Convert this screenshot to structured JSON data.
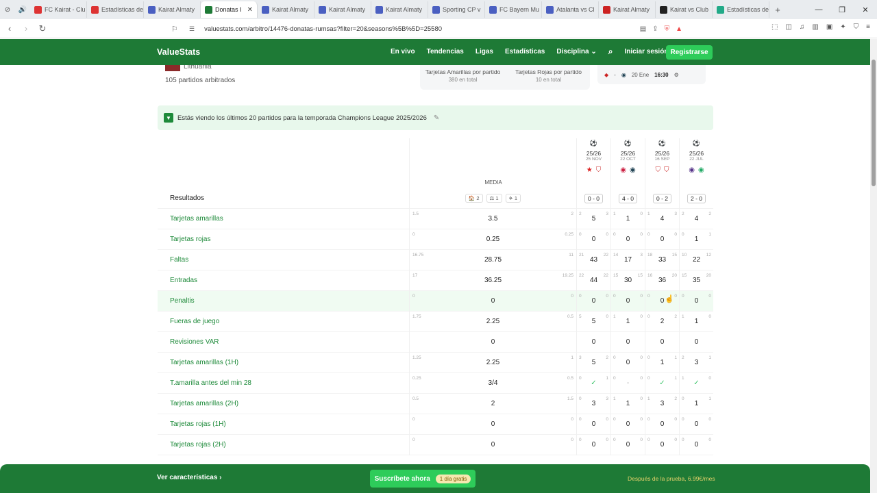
{
  "browser": {
    "tabs": [
      {
        "title": "FC Kairat - Clu",
        "color": "#d33"
      },
      {
        "title": "Estadísticas de",
        "color": "#d33"
      },
      {
        "title": "Kairat Almaty",
        "color": "#4a5fc1"
      },
      {
        "title": "Donatas I",
        "color": "#1e7a36",
        "active": true
      },
      {
        "title": "Kairat Almaty",
        "color": "#4a5fc1"
      },
      {
        "title": "Kairat Almaty",
        "color": "#4a5fc1"
      },
      {
        "title": "Kairat Almaty",
        "color": "#4a5fc1"
      },
      {
        "title": "Sporting CP v",
        "color": "#4a5fc1"
      },
      {
        "title": "FC Bayern Mu",
        "color": "#4a5fc1"
      },
      {
        "title": "Atalanta vs Cl",
        "color": "#4a5fc1"
      },
      {
        "title": "Kairat Almaty",
        "color": "#c22"
      },
      {
        "title": "Kairat vs Club",
        "color": "#222"
      },
      {
        "title": "Estadísticas de",
        "color": "#2a8"
      }
    ],
    "url": "valuestats.com/arbitro/14476-donatas-rumsas?filter=20&seasons%5B%5D=25580"
  },
  "header": {
    "logo": "ValueStats",
    "nav": [
      "En vivo",
      "Tendencias",
      "Ligas",
      "Estadísticas",
      "Disciplina"
    ],
    "login": "Iniciar sesión",
    "register": "Registrarse"
  },
  "referee": {
    "country": "Lithuania",
    "matches": "105 partidos arbitrados",
    "stats": [
      {
        "label": "Tarjetas Amarillas por partido",
        "sub": "380 en total"
      },
      {
        "label": "Tarjetas Rojas por partido",
        "sub": "10 en total"
      }
    ],
    "next": {
      "date": "20 Ene",
      "time": "16:30"
    }
  },
  "notice": "Estás viendo los últimos 20 partidos para la temporada Champions League 2025/2026",
  "table": {
    "media_label": "MEDIA",
    "badges": [
      "2",
      "1",
      "1"
    ],
    "matches": [
      {
        "season": "25/26",
        "date": "25 NOV",
        "score": "0 - 0",
        "home": "★",
        "away": "⛉",
        "hc": "#d22",
        "ac": "#c33"
      },
      {
        "season": "25/26",
        "date": "22 OCT",
        "score": "4 - 0",
        "home": "◉",
        "away": "◉",
        "hc": "#c24",
        "ac": "#245"
      },
      {
        "season": "25/26",
        "date": "16 SEP",
        "score": "0 - 2",
        "home": "⛉",
        "away": "⛉",
        "hc": "#c33",
        "ac": "#c22"
      },
      {
        "season": "25/26",
        "date": "22 JUL",
        "score": "2 - 0",
        "home": "◉",
        "away": "◉",
        "hc": "#538",
        "ac": "#2a6"
      }
    ],
    "rows": [
      {
        "label": "Tarjetas amarillas",
        "min": "1.5",
        "media": "3.5",
        "max": "2",
        "cells": [
          [
            "2",
            "5",
            "3"
          ],
          [
            "1",
            "1",
            "0"
          ],
          [
            "1",
            "4",
            "3"
          ],
          [
            "2",
            "4",
            "2"
          ]
        ]
      },
      {
        "label": "Tarjetas rojas",
        "min": "0",
        "media": "0.25",
        "max": "0.25",
        "cells": [
          [
            "0",
            "0",
            "0"
          ],
          [
            "0",
            "0",
            "0"
          ],
          [
            "0",
            "0",
            "0"
          ],
          [
            "0",
            "1",
            "1"
          ]
        ]
      },
      {
        "label": "Faltas",
        "min": "16.75",
        "media": "28.75",
        "max": "11",
        "cells": [
          [
            "21",
            "43",
            "22"
          ],
          [
            "14",
            "17",
            "3"
          ],
          [
            "18",
            "33",
            "15"
          ],
          [
            "10",
            "22",
            "12"
          ]
        ]
      },
      {
        "label": "Entradas",
        "min": "17",
        "media": "36.25",
        "max": "19.25",
        "cells": [
          [
            "22",
            "44",
            "22"
          ],
          [
            "15",
            "30",
            "15"
          ],
          [
            "16",
            "36",
            "20"
          ],
          [
            "15",
            "35",
            "20"
          ]
        ]
      },
      {
        "label": "Penaltis",
        "min": "0",
        "media": "0",
        "max": "0",
        "hl": true,
        "cells": [
          [
            "0",
            "0",
            "0"
          ],
          [
            "0",
            "0",
            "0"
          ],
          [
            "0",
            "0",
            "0"
          ],
          [
            "0",
            "0",
            "0"
          ]
        ]
      },
      {
        "label": "Fueras de juego",
        "min": "1.75",
        "media": "2.25",
        "max": "0.5",
        "cells": [
          [
            "5",
            "5",
            "0"
          ],
          [
            "1",
            "1",
            "0"
          ],
          [
            "0",
            "2",
            "2"
          ],
          [
            "1",
            "1",
            "0"
          ]
        ]
      },
      {
        "label": "Revisiones VAR",
        "min": "",
        "media": "0",
        "max": "",
        "cells": [
          [
            "",
            "0",
            ""
          ],
          [
            "",
            "0",
            ""
          ],
          [
            "",
            "0",
            ""
          ],
          [
            "",
            "0",
            ""
          ]
        ]
      },
      {
        "label": "Tarjetas amarillas (1H)",
        "min": "1.25",
        "media": "2.25",
        "max": "1",
        "cells": [
          [
            "3",
            "5",
            "2"
          ],
          [
            "0",
            "0",
            "0"
          ],
          [
            "0",
            "1",
            "1"
          ],
          [
            "2",
            "3",
            "1"
          ]
        ]
      },
      {
        "label": "T.amarilla antes del min 28",
        "min": "0.25",
        "media": "3/4",
        "max": "0.5",
        "cells": [
          [
            "0",
            "✓",
            "1"
          ],
          [
            "0",
            "-",
            "0"
          ],
          [
            "0",
            "✓",
            "1"
          ],
          [
            "1",
            "✓",
            "0"
          ]
        ]
      },
      {
        "label": "Tarjetas amarillas (2H)",
        "min": "0.5",
        "media": "2",
        "max": "1.5",
        "cells": [
          [
            "0",
            "3",
            "3"
          ],
          [
            "1",
            "1",
            "0"
          ],
          [
            "1",
            "3",
            "2"
          ],
          [
            "0",
            "1",
            "1"
          ]
        ]
      },
      {
        "label": "Tarjetas rojas (1H)",
        "min": "0",
        "media": "0",
        "max": "0",
        "cells": [
          [
            "0",
            "0",
            "0"
          ],
          [
            "0",
            "0",
            "0"
          ],
          [
            "0",
            "0",
            "0"
          ],
          [
            "0",
            "0",
            "0"
          ]
        ]
      },
      {
        "label": "Tarjetas rojas (2H)",
        "min": "0",
        "media": "0",
        "max": "0",
        "cells": [
          [
            "0",
            "0",
            "0"
          ],
          [
            "0",
            "0",
            "0"
          ],
          [
            "0",
            "0",
            "0"
          ],
          [
            "0",
            "0",
            "0"
          ]
        ]
      }
    ],
    "first_row_label": "Resultados"
  },
  "footer": {
    "features": "Ver características",
    "subscribe": "Suscríbete ahora",
    "trial": "1 día gratis",
    "price": "Después de la prueba, 6.99€/mes"
  }
}
